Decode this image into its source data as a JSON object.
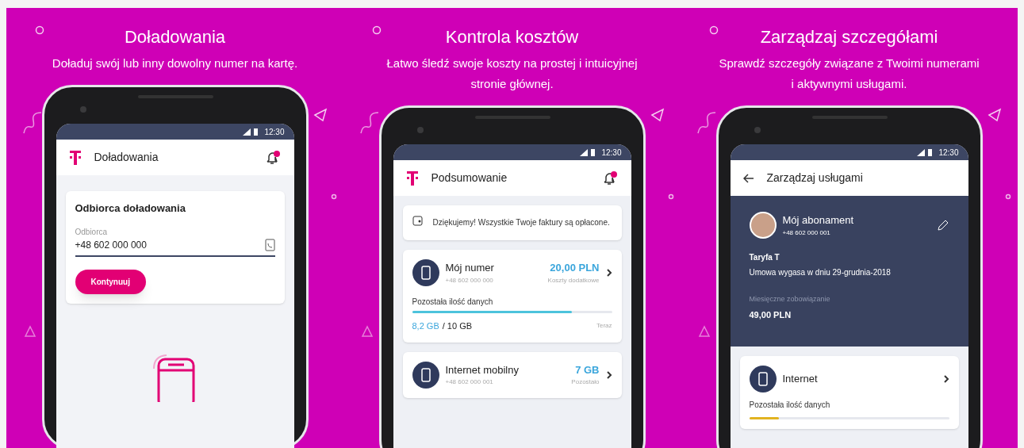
{
  "panels": [
    {
      "kind": "topup",
      "title": "Doładowania",
      "subtitle": "Doładuj swój lub inny dowolny numer na kartę.",
      "status_time": "12:30",
      "header": "Doładowania",
      "card_title": "Odbiorca doładowania",
      "field": {
        "label": "Odbiorca",
        "value": "+48 602 000 000"
      },
      "button": "Kontynuuj"
    },
    {
      "kind": "summary",
      "title": "Kontrola kosztów",
      "subtitle": "Łatwo śledź swoje koszty na prostej i intuicyjnej stronie głównej.",
      "status_time": "12:30",
      "header": "Podsumowanie",
      "notice": "Dziękujemy! Wszystkie Twoje faktury są opłacone.",
      "items": [
        {
          "name": "Mój numer",
          "number": "+48 602 000 000",
          "amount": "20,00 PLN",
          "amount_label": "Koszty dodatkowe",
          "data_label": "Pozostała ilość danych",
          "level": 0.8,
          "used": "8,2 GB",
          "total": "/ 10 GB",
          "time": "Teraz"
        },
        {
          "name": "Internet mobilny",
          "number": "+48 602 000 001",
          "amount": "7 GB",
          "amount_label": "Pozostało"
        }
      ]
    },
    {
      "kind": "manage",
      "title": "Zarządzaj szczegółami",
      "subtitle": "Sprawdź szczegóły związane z Twoimi numerami i aktywnymi usługami.",
      "status_time": "12:30",
      "header": "Zarządzaj usługami",
      "plan": {
        "name": "Mój abonament",
        "number": "+48 602 000 001",
        "tariff": "Taryfa T",
        "contract": "Umowa wygasa w dniu 29-grudnia-2018",
        "fee_label": "Miesięczne zobowiązanie",
        "fee": "49,00 PLN"
      },
      "service": {
        "name": "Internet",
        "data_label": "Pozostała ilość danych",
        "level": 0.15
      }
    }
  ]
}
